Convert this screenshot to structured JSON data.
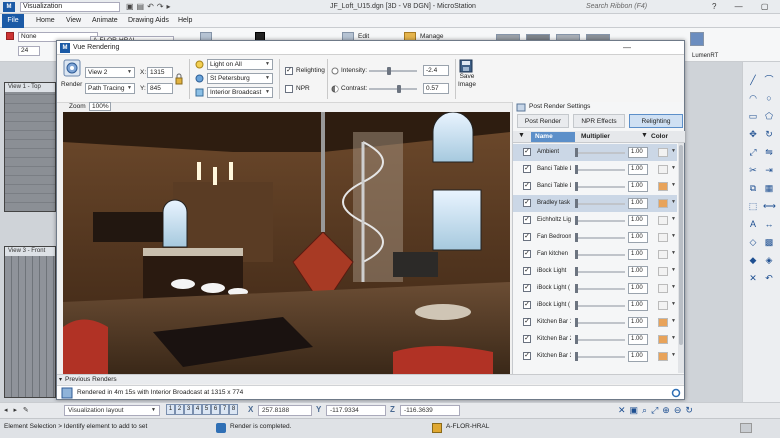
{
  "app": {
    "logo": "M",
    "workspace": "Visualization",
    "title": "JF_Loft_U15.dgn [3D - V8 DGN] - MicroStation",
    "search_placeholder": "Search Ribbon (F4)",
    "window_controls": "? — ▢ ✕"
  },
  "ribbon": {
    "tabs": [
      "File",
      "Home",
      "View",
      "Animate",
      "Drawing Aids",
      "Help"
    ],
    "level": "None",
    "level_filter": "A-FLOR-HRAL",
    "weight": "24",
    "edit_label": "Edit",
    "manage_label": "Manage",
    "lumenrt_label": "LumenRT"
  },
  "views": {
    "view1_title": "View 1 - Top",
    "view3_title": "View 3 - Front"
  },
  "vue": {
    "title": "Vue Rendering",
    "render_label": "Render",
    "view_select": "View 2",
    "method_select": "Path Tracing",
    "x_label": "X:",
    "x_value": "1315",
    "y_label": "Y:",
    "y_value": "845",
    "lighting_select": "Light on All",
    "location_select": "St Petersburg",
    "environment_select": "Interior Broadcast",
    "relighting_label": "Relighting",
    "relighting_checked": "✓",
    "npr_label": "NPR",
    "intensity_label": "Intensity:",
    "intensity_value": "-2.4",
    "contrast_label": "Contrast:",
    "contrast_value": "0.57",
    "save_image_label": "Save Image",
    "zoom_label": "Zoom",
    "zoom_value": "100%",
    "previous_renders_label": "Previous Renders",
    "status_text": "Rendered in 4m 15s with Interior Broadcast at 1315 x 774"
  },
  "post_render": {
    "title": "Post Render Settings",
    "tabs": [
      "Post Render",
      "NPR Effects",
      "Relighting"
    ],
    "active_tab": "Relighting",
    "col_name": "Name",
    "col_multiplier": "Multiplier",
    "col_color": "Color",
    "lights": [
      {
        "name": "Ambient",
        "value": "1.00",
        "color": "#f2f2f2",
        "selected": true
      },
      {
        "name": "Banci Table L",
        "value": "1.00",
        "color": "#f2f2f2",
        "selected": false
      },
      {
        "name": "Banci Table L",
        "value": "1.00",
        "color": "#e8a35a",
        "selected": false
      },
      {
        "name": "Bradley task",
        "value": "1.00",
        "color": "#e8a35a",
        "selected": true
      },
      {
        "name": "Eichholtz Ligi",
        "value": "1.00",
        "color": "#f2f2f2",
        "selected": false
      },
      {
        "name": "Fan Bedroom",
        "value": "1.00",
        "color": "#f2f2f2",
        "selected": false
      },
      {
        "name": "Fan kitchen",
        "value": "1.00",
        "color": "#f2f2f2",
        "selected": false
      },
      {
        "name": "iBock Light",
        "value": "1.00",
        "color": "#f2f2f2",
        "selected": false
      },
      {
        "name": "iBock Light (",
        "value": "1.00",
        "color": "#f2f2f2",
        "selected": false
      },
      {
        "name": "iBock Light (",
        "value": "1.00",
        "color": "#f2f2f2",
        "selected": false
      },
      {
        "name": "Kitchen Bar 1",
        "value": "1.00",
        "color": "#e8a35a",
        "selected": false
      },
      {
        "name": "Kitchen Bar 2",
        "value": "1.00",
        "color": "#e8a35a",
        "selected": false
      },
      {
        "name": "Kitchen Bar 3",
        "value": "1.00",
        "color": "#e8a35a",
        "selected": false
      }
    ]
  },
  "bottom": {
    "layout_label": "Visualization layout",
    "view_buttons": [
      "1",
      "2",
      "3",
      "4",
      "5",
      "6",
      "7",
      "8"
    ],
    "x_coord": "257.8188",
    "y_coord": "-117.9334",
    "z_coord": "-116.3639",
    "level_display": "A-FLOR-HRAL",
    "prompt": "Element Selection > Identify element to add to set",
    "message": "Render is completed."
  }
}
